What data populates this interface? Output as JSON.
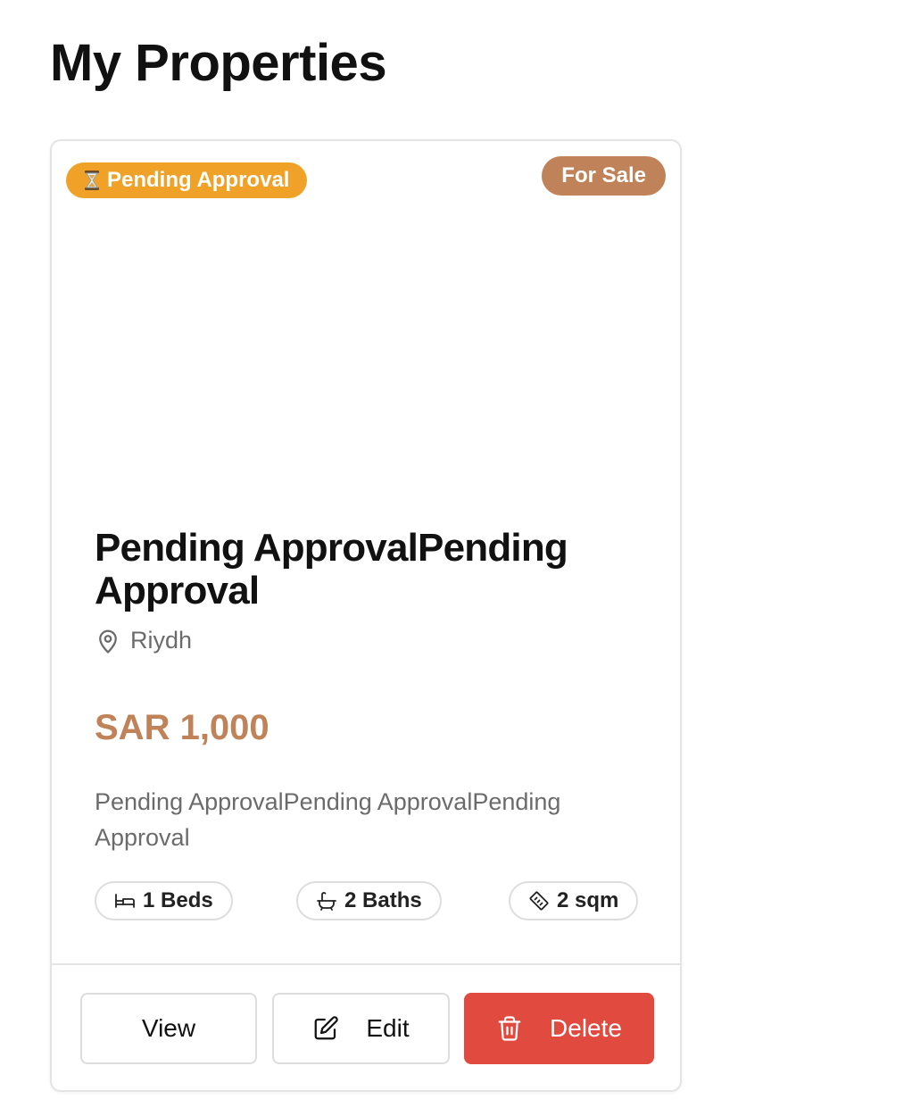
{
  "page": {
    "title": "My Properties"
  },
  "property": {
    "status_badge": "Pending Approval",
    "listing_type": "For Sale",
    "title": "Pending ApprovalPending Approval",
    "location": "Riydh",
    "price": "SAR 1,000",
    "description": "Pending ApprovalPending ApprovalPending Approval",
    "features": {
      "beds": "1 Beds",
      "baths": "2 Baths",
      "area": "2 sqm"
    }
  },
  "actions": {
    "view_label": "View",
    "edit_label": "Edit",
    "delete_label": "Delete"
  },
  "icons": {
    "status": "hourglass-icon",
    "location": "map-pin-icon",
    "beds": "bed-icon",
    "baths": "bath-icon",
    "area": "ruler-icon",
    "edit": "edit-icon",
    "delete": "trash-icon"
  },
  "colors": {
    "pending": "#f0a127",
    "for_sale": "#c08359",
    "price": "#c08359",
    "delete": "#e04a3f"
  }
}
